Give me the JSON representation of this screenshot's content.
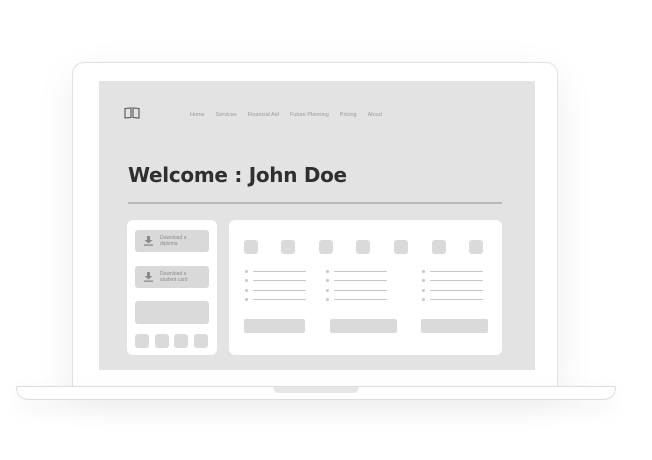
{
  "nav": {
    "items": [
      "Home",
      "Services",
      "Financial Aid",
      "Future Planning",
      "Pricing",
      "About"
    ]
  },
  "welcome": {
    "title": "Welcome : John Doe"
  },
  "sidebar": {
    "buttons": [
      {
        "line1": "Download a",
        "line2": "diploma",
        "icon": "download-icon"
      },
      {
        "line1": "Download a",
        "line2": "student card",
        "icon": "download-icon"
      }
    ]
  },
  "icons": {
    "logo": "book-icon"
  },
  "colors": {
    "screen": "#e3e3e3",
    "card": "#ffffff",
    "placeholder": "#dadada",
    "title": "#2f2f2f"
  }
}
